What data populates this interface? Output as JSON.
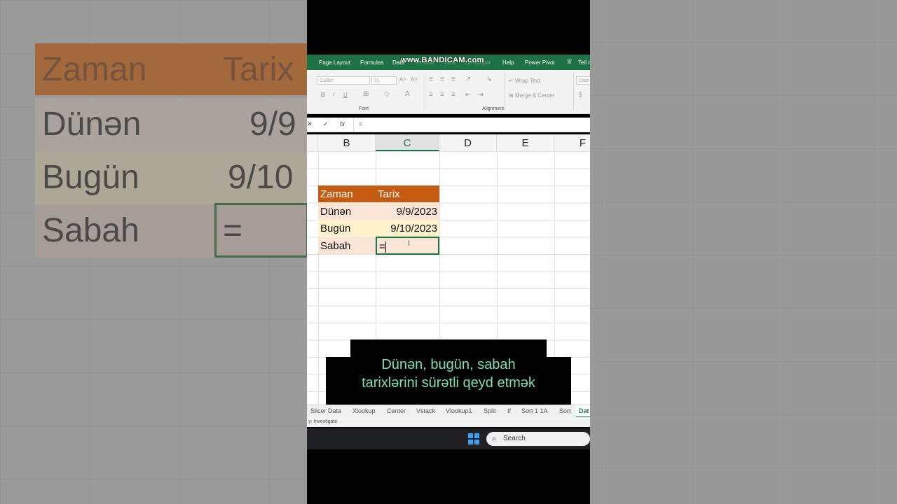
{
  "background": {
    "header_zaman": "Zaman",
    "header_tarix": "Tarix",
    "row1_label": "Dünən",
    "row1_value": "9/9",
    "row2_label": "Bugün",
    "row2_value": "9/10",
    "row3_label": "Sabah",
    "row3_value": "="
  },
  "ribbon": {
    "tabs": [
      "Page Layout",
      "Formulas",
      "Data",
      "Review",
      "View",
      "Developer",
      "Help",
      "Power Pivot",
      "Tell me"
    ],
    "watermark": "www.BANDICAM.com",
    "font_name": "Calibri",
    "font_size": "11",
    "bold": "B",
    "italic": "I",
    "underline": "U",
    "wrap_text": "Wrap Text",
    "merge_center": "Merge & Center",
    "number_format": "Date",
    "currency": "$",
    "group_font": "Font",
    "group_alignment": "Alignment"
  },
  "formula_bar": {
    "cancel": "✕",
    "enter": "✓",
    "fx": "fx",
    "content": "="
  },
  "columns": [
    "B",
    "C",
    "D",
    "E",
    "F"
  ],
  "table": {
    "header": [
      "Zaman",
      "Tarix"
    ],
    "rows": [
      {
        "label": "Dünən",
        "value": "9/9/2023"
      },
      {
        "label": "Bugün",
        "value": "9/10/2023"
      },
      {
        "label": "Sabah",
        "value": "="
      }
    ]
  },
  "caption": {
    "line1": "Dünən, bugün, sabah",
    "line2": "tarixlərini sürətli qeyd etmək"
  },
  "sheet_tabs": [
    "Slicer Data",
    "Xlookup",
    "Center",
    "Vstack",
    "Vlookup1",
    "Split",
    "If",
    "Sort 1 1A",
    "Sort",
    "Dat"
  ],
  "status_text": "y: Investigate",
  "taskbar": {
    "search_label": "Search"
  },
  "colors": {
    "excel_green": "#1e7145",
    "header_orange": "#c55a11",
    "row_peach": "#fbe5d6",
    "row_yellow": "#fff2cc",
    "caption_text": "#7ee0b0"
  }
}
